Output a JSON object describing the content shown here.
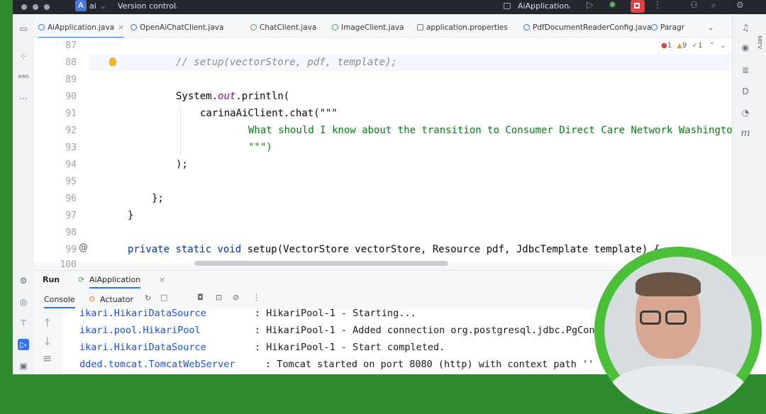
{
  "titlebar": {
    "project_badge": "A",
    "project_name": "ai",
    "vcs": "Version control",
    "run_config": "AiApplication"
  },
  "tabs": [
    {
      "label": "AiApplication.java",
      "active": true
    },
    {
      "label": "OpenAiChatClient.java"
    },
    {
      "label": "ChatClient.java"
    },
    {
      "label": "ImageClient.java"
    },
    {
      "label": "application.properties"
    },
    {
      "label": "PdfDocumentReaderConfig.java"
    },
    {
      "label": "Paragr"
    }
  ],
  "inspections": {
    "errors": "1",
    "warnings": "9",
    "weak": "1"
  },
  "editor": {
    "lines": [
      {
        "num": "87",
        "text": ""
      },
      {
        "num": "88",
        "comment": "// setup(vectorStore, pdf, template);"
      },
      {
        "num": "89",
        "text": ""
      },
      {
        "num": "90",
        "pre": "System.",
        "ital": "out",
        "post": ".println("
      },
      {
        "num": "91",
        "text": "carinaAiClient.chat(\"\"\""
      },
      {
        "num": "92",
        "str": "What should I know about the transition to Consumer Direct Care Network Washington"
      },
      {
        "num": "93",
        "str": "\"\"\")"
      },
      {
        "num": "94",
        "text": ");"
      },
      {
        "num": "95",
        "text": ""
      },
      {
        "num": "96",
        "text": "};"
      },
      {
        "num": "97",
        "text": "}"
      },
      {
        "num": "98",
        "text": ""
      },
      {
        "num": "99",
        "kw": "private static void",
        "post": " setup(VectorStore vectorStore, Resource pdf, JdbcTemplate template) {"
      },
      {
        "num": "100",
        "text": ""
      }
    ]
  },
  "run": {
    "label": "Run",
    "config": "AiApplication",
    "console_tab": "Console",
    "actuator_tab": "Actuator"
  },
  "console": {
    "lines": [
      {
        "src": "ikari.HikariDataSource",
        "msg": ": HikariPool-1 - Starting..."
      },
      {
        "src": "ikari.pool.HikariPool",
        "msg": ": HikariPool-1 - Added connection org.postgresql.jdbc.PgCon"
      },
      {
        "src": "ikari.HikariDataSource",
        "msg": ": HikariPool-1 - Start completed."
      },
      {
        "src": "dded.tomcat.TomcatWebServer",
        "msg": ": Tomcat started on port 8080 (http) with context path ''"
      }
    ]
  },
  "right_toolbar": {
    "side_label": "serv",
    "m_label": "m"
  },
  "colors": {
    "accent": "#3574f0",
    "stop": "#dd4444",
    "string": "#067d17",
    "keyword": "#0033b3"
  }
}
